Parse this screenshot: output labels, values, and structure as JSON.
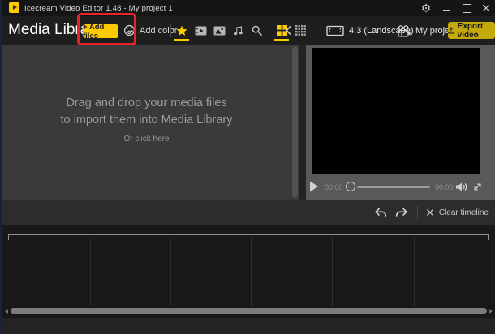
{
  "titlebar": {
    "title": "Icecream Video Editor 1.48 - My project 1"
  },
  "header": {
    "panel_title": "Media Library",
    "add_files_label": "+ Add files",
    "add_color_label": "Add color"
  },
  "preview_bar": {
    "aspect_label": "4:3 (Landscape)",
    "my_projects_label": "My projects",
    "export_label": "Export video"
  },
  "media_library": {
    "dropzone_line1": "Drag and drop your media files",
    "dropzone_line2": "to import them into Media Library",
    "dropzone_hint": "Or click here"
  },
  "player": {
    "current_time": "00:00",
    "total_time": "00:00"
  },
  "actions": {
    "clear_timeline_label": "Clear timeline"
  },
  "icons": {
    "settings_gear": "⚙"
  },
  "colors": {
    "accent_yellow": "#fbca00",
    "export_yellow": "#c4a90d",
    "annotation_red": "#e8232a"
  }
}
